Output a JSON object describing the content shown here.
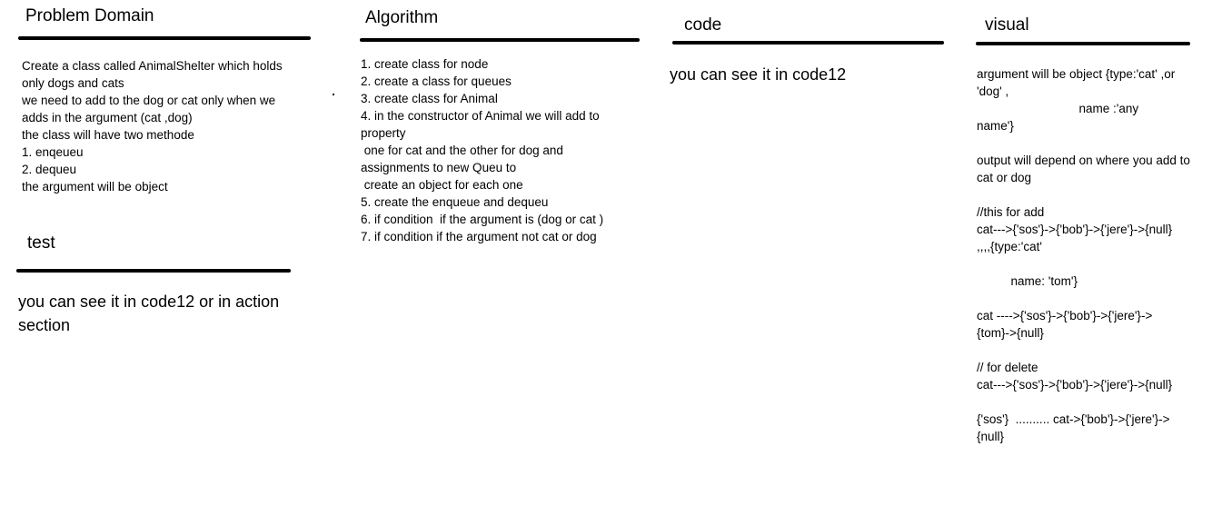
{
  "problem_domain": {
    "heading": "Problem Domain",
    "lines": [
      "Create a class called AnimalShelter which holds",
      "only dogs and cats",
      "we need to add to the dog or cat only when we",
      "adds in the argument (cat ,dog)",
      "the class will have two methode",
      "1. enqeueu",
      "2. dequeu",
      "the argument will be object"
    ]
  },
  "test": {
    "heading": "test",
    "lines": [
      "you can see it in code12 or in action",
      "section"
    ]
  },
  "algorithm": {
    "heading": "Algorithm",
    "lines": [
      "1. create class for node",
      "2. create a class for queues",
      "3. create class for Animal",
      "4. in the constructor of Animal we will add to",
      "property",
      " one for cat and the other for dog and",
      "assignments to new Queu to",
      " create an object for each one",
      "5. create the enqueue and dequeu",
      "6. if condition  if the argument is (dog or cat )",
      "7. if condition if the argument not cat or dog"
    ]
  },
  "code": {
    "heading": "code",
    "lines": [
      "you can see it in code12"
    ]
  },
  "visual": {
    "heading": "visual",
    "lines": [
      "argument will be object {type:'cat' ,or",
      "'dog' ,",
      "                              name :'any",
      "name'}",
      "",
      "output will depend on where you add to",
      "cat or dog",
      "",
      "//this for add",
      "cat--->{'sos'}->{'bob'}->{'jere'}->{null}",
      ",,,,{type:'cat'",
      "",
      "          name: 'tom'}",
      "",
      "cat ---->{'sos'}->{'bob'}->{'jere'}->",
      "{tom}->{null}",
      "",
      "// for delete",
      "cat--->{'sos'}->{'bob'}->{'jere'}->{null}",
      "",
      "{'sos'}  .......... cat->{'bob'}->{'jere'}->",
      "{null}"
    ]
  }
}
